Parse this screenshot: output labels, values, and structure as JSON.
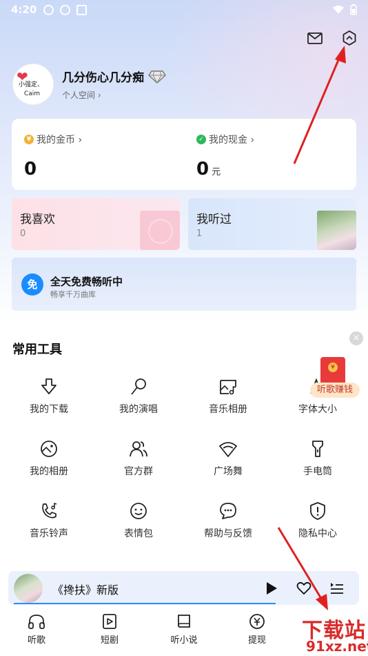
{
  "status_bar": {
    "time": "4:20"
  },
  "profile": {
    "username": "几分伤心几分痴",
    "subtitle": "个人空间 ›",
    "avatar_text_1": "小强定、",
    "avatar_text_2": "Caim"
  },
  "wallet": {
    "coins_label": "我的金币 ›",
    "coins_value": "0",
    "cash_label": "我的现金 ›",
    "cash_value": "0",
    "cash_unit": "元"
  },
  "favorites": {
    "like_label": "我喜欢",
    "like_count": "0",
    "heard_label": "我听过",
    "heard_count": "1"
  },
  "free_banner": {
    "badge": "免",
    "title": "全天免费畅听中",
    "subtitle": "畅享千万曲库"
  },
  "tools": {
    "title": "常用工具",
    "items": [
      {
        "label": "我的下载",
        "icon": "download-icon"
      },
      {
        "label": "我的演唱",
        "icon": "microphone-icon"
      },
      {
        "label": "音乐相册",
        "icon": "music-album-icon"
      },
      {
        "label": "字体大小",
        "icon": "font-size-icon"
      },
      {
        "label": "我的相册",
        "icon": "photo-album-icon"
      },
      {
        "label": "官方群",
        "icon": "group-icon"
      },
      {
        "label": "广场舞",
        "icon": "fan-icon"
      },
      {
        "label": "手电筒",
        "icon": "flashlight-icon"
      },
      {
        "label": "音乐铃声",
        "icon": "ringtone-icon"
      },
      {
        "label": "表情包",
        "icon": "smiley-icon"
      },
      {
        "label": "帮助与反馈",
        "icon": "feedback-icon"
      },
      {
        "label": "隐私中心",
        "icon": "privacy-shield-icon"
      }
    ]
  },
  "promo": {
    "label": "听歌赚钱"
  },
  "player": {
    "title": "《搀扶》新版"
  },
  "nav": [
    {
      "label": "听歌",
      "icon": "headphones-icon"
    },
    {
      "label": "短剧",
      "icon": "video-play-icon"
    },
    {
      "label": "听小说",
      "icon": "book-icon"
    },
    {
      "label": "提现",
      "icon": "withdraw-icon"
    }
  ],
  "watermark": {
    "line1": "下载站",
    "line2": "91xz.net"
  },
  "colors": {
    "accent_blue": "#1a8cff",
    "arrow_red": "#e02020",
    "coin": "#f4b232",
    "cash": "#2eb85c"
  }
}
